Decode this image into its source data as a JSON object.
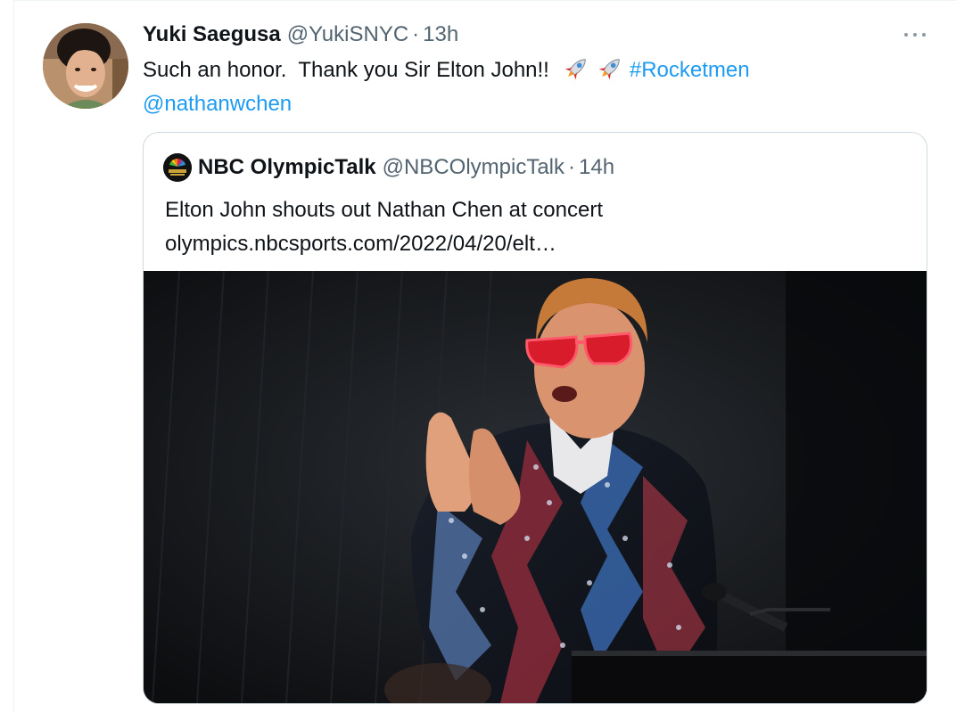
{
  "tweet": {
    "author": {
      "display_name": "Yuki Saegusa",
      "handle": "@YukiSNYC",
      "separator": "·",
      "time": "13h"
    },
    "text_before": "Such an honor.  Thank you Sir Elton John!!",
    "emoji": [
      "rocket-icon",
      "rocket-icon"
    ],
    "hashtag": "#Rocketmen",
    "mention": "@nathanwchen",
    "more_icon": "more-horizontal-icon",
    "link_color": "#1d9bf0"
  },
  "quote": {
    "author": {
      "display_name": "NBC OlympicTalk",
      "handle": "@NBCOlympicTalk",
      "separator": "·",
      "time": "14h"
    },
    "text": "Elton John shouts out Nathan Chen at concert",
    "link": "olympics.nbcsports.com/2022/04/20/elt…",
    "image_description_icon": "photo-elton-john-clapping"
  }
}
